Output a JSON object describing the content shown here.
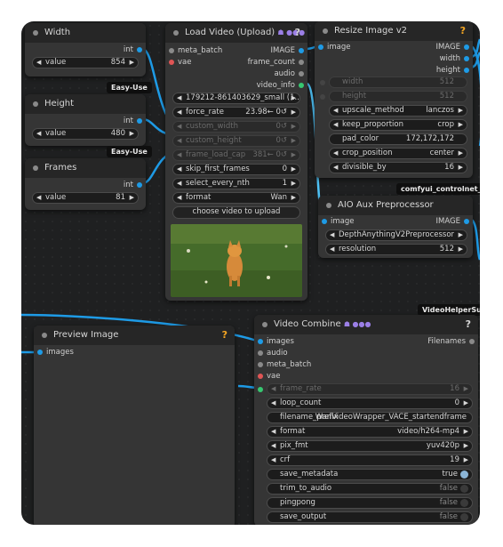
{
  "colors": {
    "wire_blue": "#1e9be6",
    "wire_cyan": "#4fc3f7",
    "badge_bg": "#0f0f0f",
    "slot_blue": "#1e9be6",
    "slot_red": "#e05555",
    "slot_green": "#37c871",
    "link_purple": "#9b7fe6"
  },
  "width_node": {
    "title": "Width",
    "output": "int",
    "value_label": "value",
    "value": "854",
    "badge": "Easy-Use"
  },
  "height_node": {
    "title": "Height",
    "output": "int",
    "value_label": "value",
    "value": "480",
    "badge": "Easy-Use"
  },
  "frames_node": {
    "title": "Frames",
    "output": "int",
    "value_label": "value",
    "value": "81"
  },
  "load_video": {
    "title": "Load Video (Upload)",
    "help": "?",
    "inputs": [
      "meta_batch",
      "vae"
    ],
    "outputs": [
      "IMAGE",
      "frame_count",
      "audio",
      "video_info"
    ],
    "video": "179212-861403629_small (1...",
    "force_rate_label": "force_rate",
    "force_rate_value": "23.98← 0↺",
    "custom_width_label": "custom_width",
    "custom_width_value": "0↺",
    "custom_height_label": "custom_height",
    "custom_height_value": "0↺",
    "frame_load_cap_label": "frame_load_cap",
    "frame_load_cap_value": "381← 0↺",
    "skip_first_frames_label": "skip_first_frames",
    "skip_first_frames_value": "0",
    "select_every_nth_label": "select_every_nth",
    "select_every_nth_value": "1",
    "format_label": "format",
    "format_value": "Wan",
    "upload_button": "choose video to upload"
  },
  "resize_node": {
    "title": "Resize Image v2",
    "help": "?",
    "input": "image",
    "outputs": [
      "IMAGE",
      "width",
      "height"
    ],
    "width_label": "width",
    "width_value": "512",
    "height_label": "height",
    "height_value": "512",
    "upscale_method_label": "upscale_method",
    "upscale_method_value": "lanczos",
    "keep_proportion_label": "keep_proportion",
    "keep_proportion_value": "crop",
    "pad_color_label": "pad_color",
    "pad_color_value": "172,172,172",
    "crop_position_label": "crop_position",
    "crop_position_value": "center",
    "divisible_by_label": "divisible_by",
    "divisible_by_value": "16",
    "badge": "comfyui_controlnet_aux"
  },
  "aio_node": {
    "title": "AIO Aux Preprocessor",
    "input": "image",
    "output": "IMAGE",
    "preprocessor": "DepthAnythingV2Preprocessor",
    "resolution_label": "resolution",
    "resolution_value": "512",
    "badge": "VideoHelperSuite"
  },
  "preview_node": {
    "title": "Preview Image",
    "help": "?",
    "input": "images"
  },
  "combine_node": {
    "title": "Video Combine",
    "help": "?",
    "inputs": [
      "images",
      "audio",
      "meta_batch",
      "vae"
    ],
    "output": "Filenames",
    "frame_rate_label": "frame_rate",
    "frame_rate_value": "16",
    "loop_count_label": "loop_count",
    "loop_count_value": "0",
    "filename_prefix_label": "filename_prefix",
    "filename_prefix_value": "WanVideoWrapper_VACE_startendframe",
    "format_label": "format",
    "format_value": "video/h264-mp4",
    "pix_fmt_label": "pix_fmt",
    "pix_fmt_value": "yuv420p",
    "crf_label": "crf",
    "crf_value": "19",
    "save_metadata_label": "save_metadata",
    "save_metadata_value": "true",
    "trim_to_audio_label": "trim_to_audio",
    "trim_to_audio_value": "false",
    "pingpong_label": "pingpong",
    "pingpong_value": "false",
    "save_output_label": "save_output",
    "save_output_value": "false"
  }
}
